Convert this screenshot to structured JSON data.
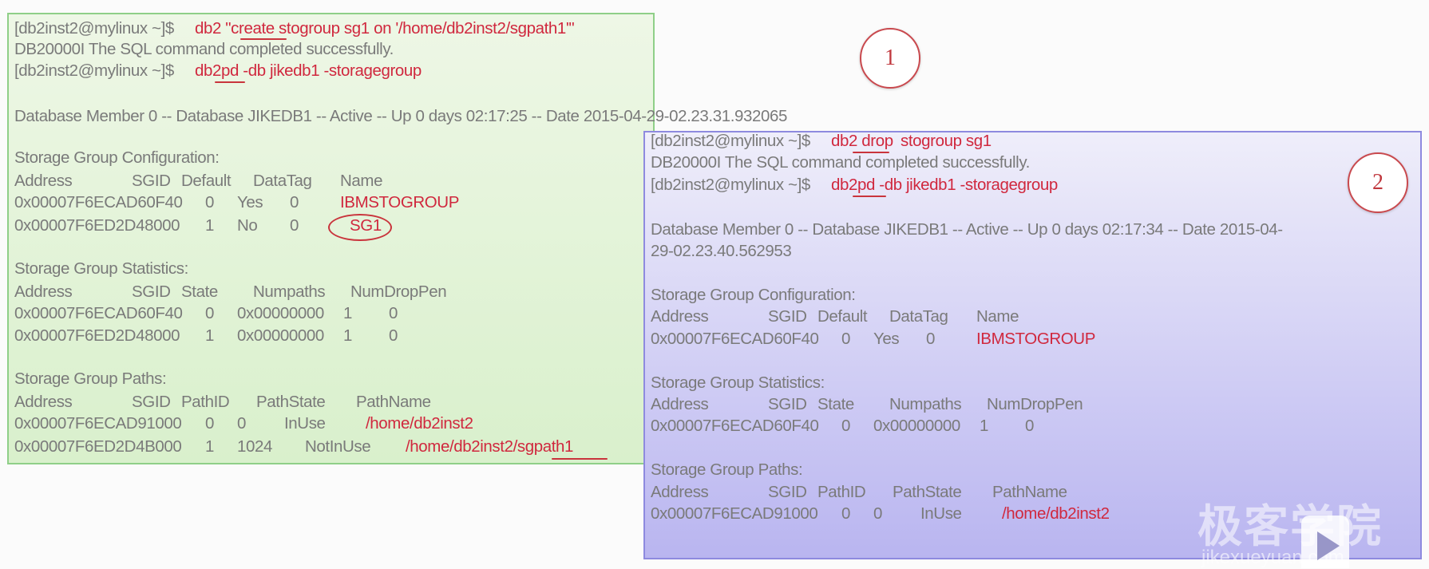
{
  "panel1": {
    "badge": "1",
    "cmd1_prompt": "[db2inst2@mylinux ~]$",
    "cmd1": "db2 \"create stogroup sg1 on '/home/db2inst2/sgpath1'\"",
    "msg": "DB20000I  The SQL command completed successfully.",
    "cmd2_prompt": "[db2inst2@mylinux ~]$",
    "cmd2": "db2pd -db jikedb1 -storagegroup",
    "dbline": "Database Member 0 -- Database JIKEDB1 -- Active -- Up 0 days 02:17:25 -- Date 2015-04-29-02.23.31.932065",
    "config_title": "Storage Group Configuration:",
    "config_headers": [
      "Address",
      "SGID",
      "Default",
      "DataTag",
      "Name"
    ],
    "config_rows": [
      [
        "0x00007F6ECAD60F40",
        "0",
        "Yes",
        "0",
        "IBMSTOGROUP"
      ],
      [
        "0x00007F6ED2D48000",
        "1",
        "No",
        "0",
        "SG1"
      ]
    ],
    "stats_title": "Storage Group Statistics:",
    "stats_headers": [
      "Address",
      "SGID",
      "State",
      "Numpaths",
      "NumDropPen"
    ],
    "stats_rows": [
      [
        "0x00007F6ECAD60F40",
        "0",
        "0x00000000",
        "1",
        "0"
      ],
      [
        "0x00007F6ED2D48000",
        "1",
        "0x00000000",
        "1",
        "0"
      ]
    ],
    "paths_title": "Storage Group Paths:",
    "paths_headers": [
      "Address",
      "SGID",
      "PathID",
      "PathState",
      "PathName"
    ],
    "paths_rows": [
      [
        "0x00007F6ECAD91000",
        "0",
        "0",
        "InUse",
        "/home/db2inst2"
      ],
      [
        "0x00007F6ED2D4B000",
        "1",
        "1024",
        "NotInUse",
        "/home/db2inst2/sgpath1"
      ]
    ]
  },
  "panel2": {
    "badge": "2",
    "cmd1_prompt": "[db2inst2@mylinux ~]$",
    "cmd1": "db2 drop",
    "cmd1_rest": "stogroup sg1",
    "msg": "DB20000I  The SQL command completed successfully.",
    "cmd2_prompt": "[db2inst2@mylinux ~]$",
    "cmd2": "db2pd -db jikedb1 -storagegroup",
    "dbline1": "Database Member 0 -- Database JIKEDB1 -- Active -- Up 0 days 02:17:34 -- Date 2015-04-",
    "dbline2": "29-02.23.40.562953",
    "config_title": "Storage Group Configuration:",
    "config_headers": [
      "Address",
      "SGID",
      "Default",
      "DataTag",
      "Name"
    ],
    "config_rows": [
      [
        "0x00007F6ECAD60F40",
        "0",
        "Yes",
        "0",
        "IBMSTOGROUP"
      ]
    ],
    "stats_title": "Storage Group Statistics:",
    "stats_headers": [
      "Address",
      "SGID",
      "State",
      "Numpaths",
      "NumDropPen"
    ],
    "stats_rows": [
      [
        "0x00007F6ECAD60F40",
        "0",
        "0x00000000",
        "1",
        "0"
      ]
    ],
    "paths_title": "Storage Group Paths:",
    "paths_headers": [
      "Address",
      "SGID",
      "PathID",
      "PathState",
      "PathName"
    ],
    "paths_rows": [
      [
        "0x00007F6ECAD91000",
        "0",
        "0",
        "InUse",
        "/home/db2inst2"
      ]
    ]
  },
  "watermark": {
    "brand": "极客学院",
    "url": "jikexueyuan.com"
  },
  "colors": {
    "command_red": "#d0283e",
    "panel1_bg": "#dff2d2",
    "panel2_bg": "#c8c5f3",
    "text_gray": "#7a7a7a"
  }
}
